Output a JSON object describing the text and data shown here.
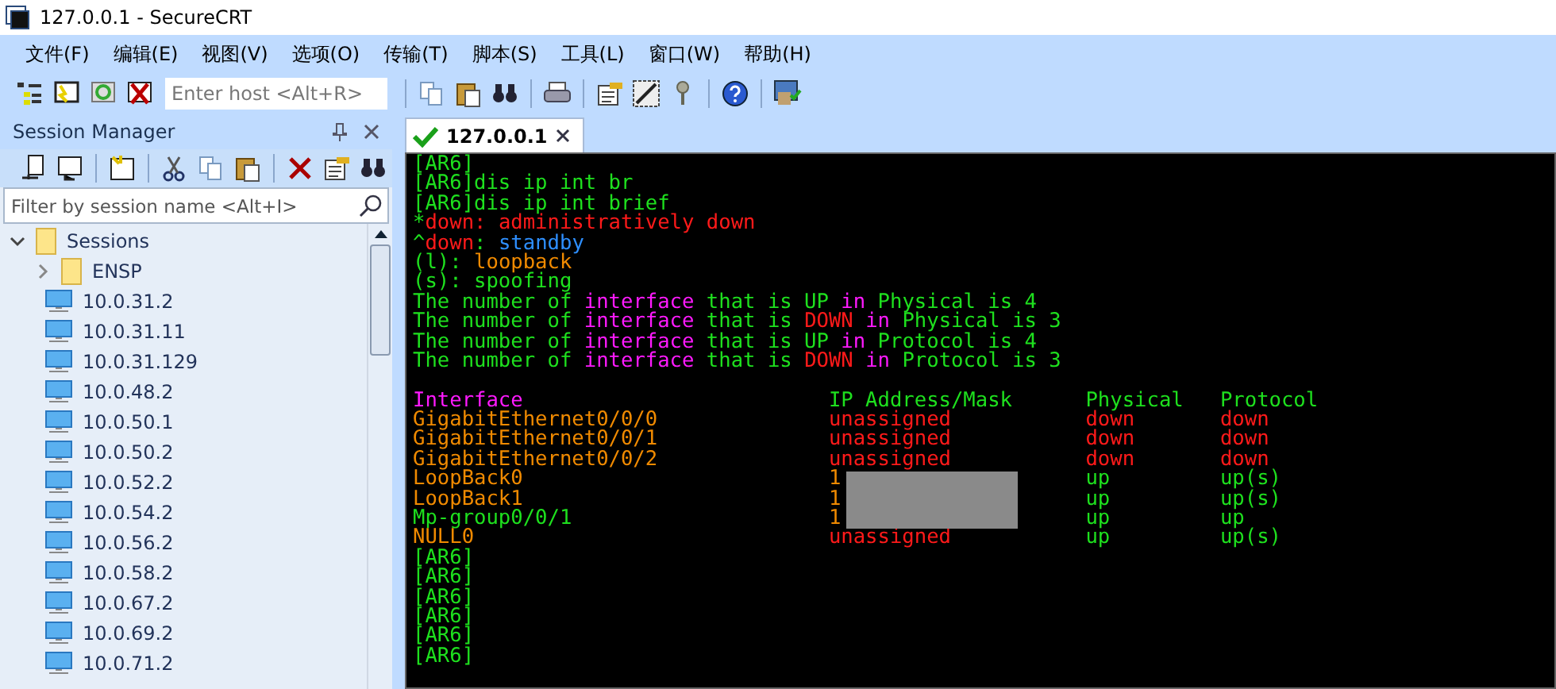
{
  "window": {
    "title": "127.0.0.1 - SecureCRT"
  },
  "menu": [
    "文件(F)",
    "编辑(E)",
    "视图(V)",
    "选项(O)",
    "传输(T)",
    "脚本(S)",
    "工具(L)",
    "窗口(W)",
    "帮助(H)"
  ],
  "toolbar": {
    "host_field": {
      "placeholder": "Enter host <Alt+R>"
    }
  },
  "session_manager": {
    "title": "Session Manager",
    "filter": {
      "placeholder": "Filter by session name <Alt+I>"
    },
    "tree": [
      {
        "label": "Sessions",
        "kind": "folder",
        "expanded": true,
        "children": [
          {
            "label": "ENSP",
            "kind": "folder",
            "expanded": false
          },
          {
            "label": "10.0.31.2",
            "kind": "session"
          },
          {
            "label": "10.0.31.11",
            "kind": "session"
          },
          {
            "label": "10.0.31.129",
            "kind": "session"
          },
          {
            "label": "10.0.48.2",
            "kind": "session"
          },
          {
            "label": "10.0.50.1",
            "kind": "session"
          },
          {
            "label": "10.0.50.2",
            "kind": "session"
          },
          {
            "label": "10.0.52.2",
            "kind": "session"
          },
          {
            "label": "10.0.54.2",
            "kind": "session"
          },
          {
            "label": "10.0.56.2",
            "kind": "session"
          },
          {
            "label": "10.0.58.2",
            "kind": "session"
          },
          {
            "label": "10.0.67.2",
            "kind": "session"
          },
          {
            "label": "10.0.69.2",
            "kind": "session"
          },
          {
            "label": "10.0.71.2",
            "kind": "session"
          }
        ]
      }
    ]
  },
  "tabs": [
    {
      "label": "127.0.0.1",
      "selected": true,
      "connected": true
    }
  ],
  "terminal": {
    "lines_before": [
      [
        {
          "text": "[AR6]",
          "color": "#1ee01e"
        }
      ],
      [
        {
          "text": "[AR6]dis ip int br",
          "color": "#1ee01e"
        }
      ],
      [
        {
          "text": "[AR6]dis ip int brief",
          "color": "#1ee01e"
        }
      ],
      [
        {
          "text": "*",
          "color": "#1ee01e"
        },
        {
          "text": "down: administratively down",
          "color": "#ff1a1a"
        }
      ],
      [
        {
          "text": "^",
          "color": "#1ee01e"
        },
        {
          "text": "down",
          "color": "#ff1a1a"
        },
        {
          "text": ": ",
          "color": "#1ee01e"
        },
        {
          "text": "standby",
          "color": "#2e8fff"
        }
      ],
      [
        {
          "text": "(l): ",
          "color": "#1ee01e"
        },
        {
          "text": "loopback",
          "color": "#f08a00"
        }
      ],
      [
        {
          "text": "(s): spoofing",
          "color": "#1ee01e"
        }
      ],
      [
        {
          "text": "The number of ",
          "color": "#1ee01e"
        },
        {
          "text": "interface",
          "color": "#ff1aff"
        },
        {
          "text": " that is UP ",
          "color": "#1ee01e"
        },
        {
          "text": "in",
          "color": "#ff1aff"
        },
        {
          "text": " Physical is 4",
          "color": "#1ee01e"
        }
      ],
      [
        {
          "text": "The number of ",
          "color": "#1ee01e"
        },
        {
          "text": "interface",
          "color": "#ff1aff"
        },
        {
          "text": " that is ",
          "color": "#1ee01e"
        },
        {
          "text": "DOWN",
          "color": "#ff1a1a"
        },
        {
          "text": " in",
          "color": "#ff1aff"
        },
        {
          "text": " Physical is 3",
          "color": "#1ee01e"
        }
      ],
      [
        {
          "text": "The number of ",
          "color": "#1ee01e"
        },
        {
          "text": "interface",
          "color": "#ff1aff"
        },
        {
          "text": " that is UP ",
          "color": "#1ee01e"
        },
        {
          "text": "in",
          "color": "#ff1aff"
        },
        {
          "text": " Protocol is 4",
          "color": "#1ee01e"
        }
      ],
      [
        {
          "text": "The number of ",
          "color": "#1ee01e"
        },
        {
          "text": "interface",
          "color": "#ff1aff"
        },
        {
          "text": " that is ",
          "color": "#1ee01e"
        },
        {
          "text": "DOWN",
          "color": "#ff1a1a"
        },
        {
          "text": " in",
          "color": "#ff1aff"
        },
        {
          "text": " Protocol is 3",
          "color": "#1ee01e"
        }
      ]
    ],
    "table": {
      "columns": [
        {
          "label": "Interface",
          "color": "#ff1aff"
        },
        {
          "label": "IP Address/Mask",
          "color": "#1ee01e"
        },
        {
          "label": "Physical",
          "color": "#1ee01e"
        },
        {
          "label": "Protocol",
          "color": "#1ee01e"
        }
      ],
      "rows": [
        [
          {
            "text": "GigabitEthernet0/0/0",
            "color": "#f08a00"
          },
          {
            "text": "unassigned",
            "color": "#ff1a1a"
          },
          {
            "text": "down",
            "color": "#ff1a1a"
          },
          {
            "text": "down",
            "color": "#ff1a1a"
          }
        ],
        [
          {
            "text": "GigabitEthernet0/0/1",
            "color": "#f08a00"
          },
          {
            "text": "unassigned",
            "color": "#ff1a1a"
          },
          {
            "text": "down",
            "color": "#ff1a1a"
          },
          {
            "text": "down",
            "color": "#ff1a1a"
          }
        ],
        [
          {
            "text": "GigabitEthernet0/0/2",
            "color": "#f08a00"
          },
          {
            "text": "unassigned",
            "color": "#ff1a1a"
          },
          {
            "text": "down",
            "color": "#ff1a1a"
          },
          {
            "text": "down",
            "color": "#ff1a1a"
          }
        ],
        [
          {
            "text": "LoopBack0",
            "color": "#f08a00"
          },
          {
            "text": "1",
            "color": "#f08a00"
          },
          {
            "text": "up",
            "color": "#1ee01e"
          },
          {
            "text": "up(s)",
            "color": "#1ee01e"
          }
        ],
        [
          {
            "text": "LoopBack1",
            "color": "#f08a00"
          },
          {
            "text": "1",
            "color": "#f08a00"
          },
          {
            "text": "up",
            "color": "#1ee01e"
          },
          {
            "text": "up(s)",
            "color": "#1ee01e"
          }
        ],
        [
          {
            "text": "Mp-group0/0/1",
            "color": "#1ee01e"
          },
          {
            "text": "1",
            "color": "#f08a00"
          },
          {
            "text": "up",
            "color": "#1ee01e"
          },
          {
            "text": "up",
            "color": "#1ee01e"
          }
        ],
        [
          {
            "text": "NULL0",
            "color": "#f08a00"
          },
          {
            "text": "unassigned",
            "color": "#ff1a1a"
          },
          {
            "text": "up",
            "color": "#1ee01e"
          },
          {
            "text": "up(s)",
            "color": "#1ee01e"
          }
        ]
      ]
    },
    "lines_after": [
      [
        {
          "text": "[AR6]",
          "color": "#1ee01e"
        }
      ],
      [
        {
          "text": "[AR6]",
          "color": "#1ee01e"
        }
      ],
      [
        {
          "text": "[AR6]",
          "color": "#1ee01e"
        }
      ],
      [
        {
          "text": "[AR6]",
          "color": "#1ee01e"
        }
      ],
      [
        {
          "text": "[AR6]",
          "color": "#1ee01e"
        }
      ],
      [
        {
          "text": "[AR6]",
          "color": "#1ee01e"
        }
      ]
    ]
  }
}
